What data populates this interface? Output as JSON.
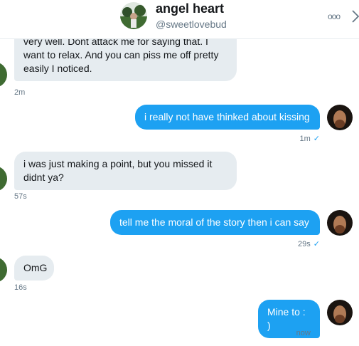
{
  "header": {
    "name": "angel heart",
    "handle": "@sweetlovebud",
    "more_glyph": "ooo"
  },
  "messages": [
    {
      "dir": "in",
      "text": "very well.  Dont attack me for saying that. I want to relax.  And you can piss me off pretty easily I noticed.",
      "time": "2m"
    },
    {
      "dir": "out",
      "text": "i really not have thinked about kissing",
      "time": "1m",
      "check": "✓"
    },
    {
      "dir": "in",
      "text": "i was just making a point, but you missed it didnt ya?",
      "time": "57s"
    },
    {
      "dir": "out",
      "text": "tell me the moral of the story then i can say",
      "time": "29s",
      "check": "✓"
    },
    {
      "dir": "in",
      "text": "OmG",
      "time": "16s"
    },
    {
      "dir": "out",
      "text": "Mine to : )",
      "time": "now",
      "check": "✓"
    }
  ],
  "colors": {
    "sent_bubble": "#1da1f2",
    "received_bubble": "#e6ecf0",
    "meta_text": "#657786"
  }
}
